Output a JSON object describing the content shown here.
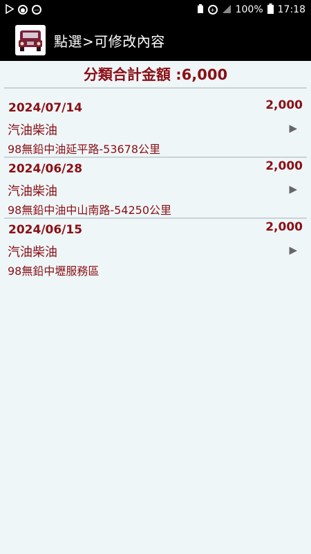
{
  "status_bar": {
    "battery": "100%",
    "time": "17:18"
  },
  "app_bar": {
    "title": "點選>可修改內容"
  },
  "summary": {
    "text": "分類合計金額 :6,000"
  },
  "records": [
    {
      "date": "2024/07/14",
      "amount": "2,000",
      "category": "汽油柴油",
      "note": "98無鉛中油延平路-53678公里"
    },
    {
      "date": "2024/06/28",
      "amount": "2,000",
      "category": "汽油柴油",
      "note": "98無鉛中油中山南路-54250公里"
    },
    {
      "date": "2024/06/15",
      "amount": "2,000",
      "category": "汽油柴油",
      "note": "98無鉛中壢服務區"
    }
  ],
  "colors": {
    "accent": "#8b0f15",
    "background": "#eef6f8",
    "bar": "#000000"
  }
}
